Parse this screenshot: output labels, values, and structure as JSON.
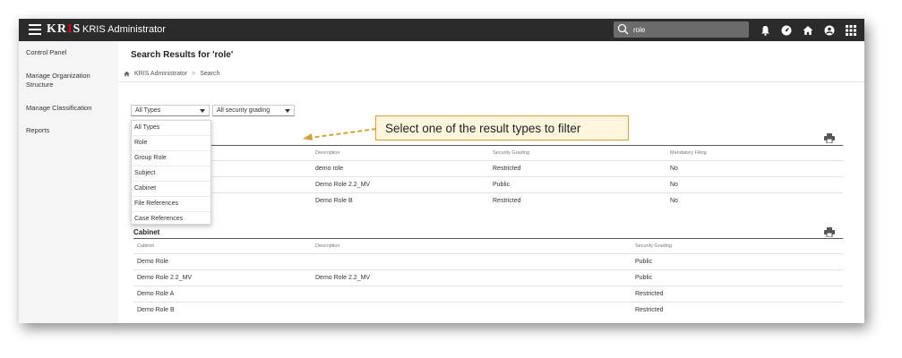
{
  "topbar": {
    "logo_left": "KR",
    "logo_mid": "I",
    "logo_right": "S",
    "app_title": "KRIS Administrator",
    "search_value": "role",
    "icons": [
      "bell-icon",
      "dashboard-icon",
      "home-icon",
      "user-icon",
      "apps-grid-icon"
    ]
  },
  "sidebar": {
    "items": [
      {
        "label": "Control Panel"
      },
      {
        "label": "Manage Organization Structure"
      },
      {
        "label": "Manage Classification"
      },
      {
        "label": "Reports"
      }
    ]
  },
  "main": {
    "title": "Search Results for 'role'",
    "breadcrumb": [
      "KRIS Administrator",
      "Search"
    ],
    "filters": {
      "type_selected": "All Types",
      "grading_selected": "All security grading"
    },
    "dropdown_options": [
      "All Types",
      "Role",
      "Group Role",
      "Subject",
      "Cabinet",
      "File References",
      "Case References"
    ],
    "role_table": {
      "headers": [
        "Description",
        "Security Grading",
        "Mandatory Filing"
      ],
      "rows": [
        [
          "demo role",
          "Restricted",
          "No"
        ],
        [
          "Demo Role 2.2_MV",
          "Public",
          "No"
        ],
        [
          "Demo Role B",
          "Restricted",
          "No"
        ]
      ]
    },
    "cabinet_section": {
      "title": "Cabinet",
      "headers": [
        "Cabinet",
        "Description",
        "Security Grading"
      ],
      "rows": [
        [
          "Demo Role",
          "",
          "Public"
        ],
        [
          "Demo Role 2.2_MV",
          "Demo Role 2.2_MV",
          "Public"
        ],
        [
          "Demo Role A",
          "",
          "Restricted"
        ],
        [
          "Demo Role B",
          "",
          "Restricted"
        ]
      ]
    }
  },
  "callout": {
    "text": "Select one of the result types to filter"
  },
  "colors": {
    "topbar": "#2b2b2b",
    "logo_accent": "#d0021b",
    "callout_bg": "#fdf5dc",
    "callout_border": "#d4a23a"
  }
}
